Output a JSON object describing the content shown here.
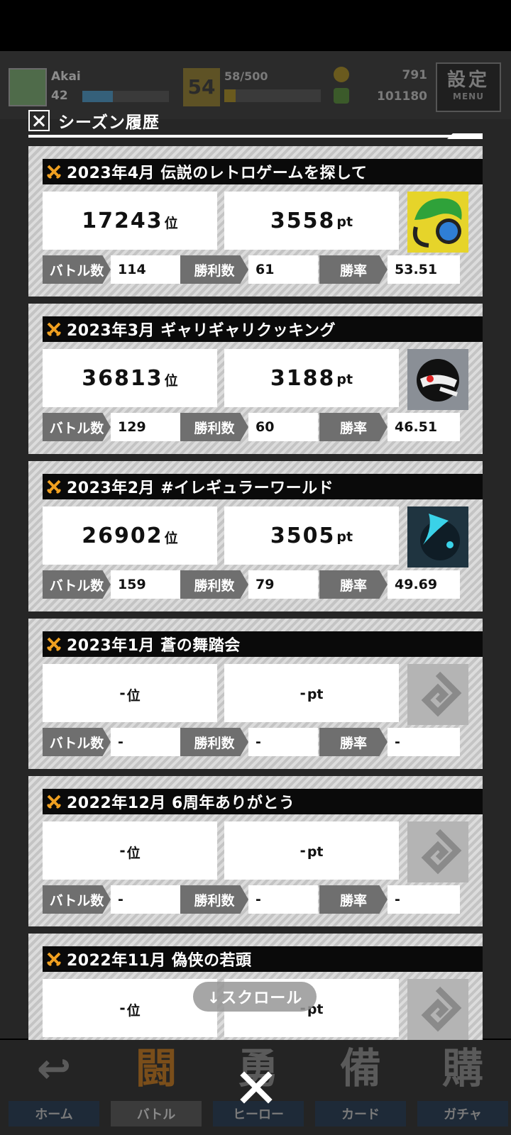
{
  "header": {
    "player_name": "Akai",
    "player_level": "42",
    "xp_fill": 0.35,
    "rank_badge": "54",
    "stamina": "58/500",
    "stamina_fill": 0.12,
    "coins": "791",
    "gems": "101180",
    "menu_kanji": "設定",
    "menu_en": "MENU"
  },
  "modal": {
    "title": "シーズン履歴",
    "scroll_hint": "↓スクロール",
    "labels": {
      "battles": "バトル数",
      "wins": "勝利数",
      "win_rate": "勝率",
      "rank_unit": "位",
      "pt_unit": "pt"
    },
    "seasons": [
      {
        "title": "2023年4月 伝説のレトロゲームを探して",
        "rank": "17243",
        "pt": "3558",
        "battles": "114",
        "wins": "61",
        "win_rate": "53.51",
        "hero": "green-hair-hero"
      },
      {
        "title": "2023年3月 ギャリギャリクッキング",
        "rank": "36813",
        "pt": "3188",
        "battles": "129",
        "wins": "60",
        "win_rate": "46.51",
        "hero": "masked-hero"
      },
      {
        "title": "2023年2月 #イレギュラーワールド",
        "rank": "26902",
        "pt": "3505",
        "battles": "159",
        "wins": "79",
        "win_rate": "49.69",
        "hero": "dark-blue-hero"
      },
      {
        "title": "2023年1月 蒼の舞踏会",
        "rank": "-",
        "pt": "-",
        "battles": "-",
        "wins": "-",
        "win_rate": "-",
        "hero": "empty"
      },
      {
        "title": "2022年12月 6周年ありがとう",
        "rank": "-",
        "pt": "-",
        "battles": "-",
        "wins": "-",
        "win_rate": "-",
        "hero": "empty"
      },
      {
        "title": "2022年11月 偽侠の若頭",
        "rank": "-",
        "pt": "-",
        "battles": "",
        "wins": "",
        "win_rate": "",
        "hero": "empty"
      }
    ]
  },
  "nav": {
    "items": [
      {
        "label": "ホーム",
        "icon": "home-icon",
        "glyph": "↩"
      },
      {
        "label": "バトル",
        "icon": "battle-icon",
        "glyph": "闘"
      },
      {
        "label": "ヒーロー",
        "icon": "hero-icon",
        "glyph": "勇"
      },
      {
        "label": "カード",
        "icon": "card-icon",
        "glyph": "備"
      },
      {
        "label": "ガチャ",
        "icon": "gacha-icon",
        "glyph": "購"
      }
    ]
  },
  "close": {
    "icon": "close-icon"
  }
}
